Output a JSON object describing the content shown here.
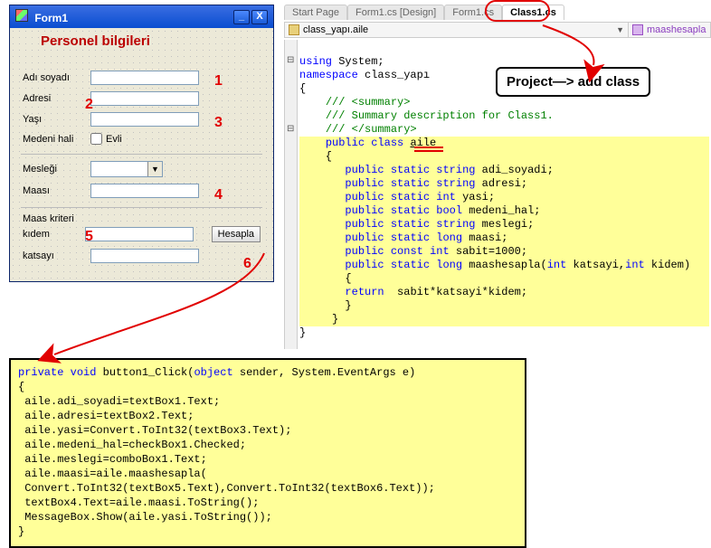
{
  "window": {
    "title": "Form1",
    "close": "X",
    "min": "_"
  },
  "form": {
    "groupTitle": "Personel bilgileri",
    "labels": {
      "adsoyad": "Adı soyadı",
      "adresi": "Adresi",
      "yasi": "Yaşı",
      "medeni": "Medeni hali",
      "evli": "Evli",
      "meslegi": "Mesleği",
      "maasi": "Maası",
      "maaskriteri": "Maas kriteri",
      "kidem": "kıdem",
      "katsayi": "katsayı",
      "hesapla": "Hesapla"
    },
    "numbers": {
      "n1": "1",
      "n2": "2",
      "n3": "3",
      "n4": "4",
      "n5": "5",
      "n6": "6"
    }
  },
  "tabs": {
    "start": "Start Page",
    "design": "Form1.cs [Design]",
    "form": "Form1.cs",
    "class": "Class1.cs"
  },
  "classbar": {
    "left": "class_yapı.aile",
    "right": "maashesapla"
  },
  "callout": "Project—> add class",
  "code": {
    "l1": "using System;",
    "l2": "namespace class_yapı",
    "l3": "{",
    "l4": "    /// <summary>",
    "l5": "    /// Summary description for Class1.",
    "l6": "    /// </summary>",
    "l7": "    public class aile",
    "l8": "    {",
    "l9": "       public static string adi_soyadi;",
    "l10": "       public static string adresi;",
    "l11": "       public static int yasi;",
    "l12": "       public static bool medeni_hal;",
    "l13": "       public static string meslegi;",
    "l14": "       public static long maasi;",
    "l15": "       public const int sabit=1000;",
    "l16": "       public static long maashesapla(int katsayi,int kidem)",
    "l17": "       {",
    "l18": "       return  sabit*katsayi*kidem;",
    "l19": "       }",
    "l20": "     }",
    "l21": "}"
  },
  "bottom": {
    "b1": "private void button1_Click(object sender, System.EventArgs e)",
    "b2": "{",
    "b3": " aile.adi_soyadi=textBox1.Text;",
    "b4": " aile.adresi=textBox2.Text;",
    "b5": " aile.yasi=Convert.ToInt32(textBox3.Text);",
    "b6": " aile.medeni_hal=checkBox1.Checked;",
    "b7": " aile.meslegi=comboBox1.Text;",
    "b8": " aile.maasi=aile.maashesapla(",
    "b9": " Convert.ToInt32(textBox5.Text),Convert.ToInt32(textBox6.Text));",
    "b10": " textBox4.Text=aile.maasi.ToString();",
    "b11": " MessageBox.Show(aile.yasi.ToString());",
    "b12": "}"
  }
}
